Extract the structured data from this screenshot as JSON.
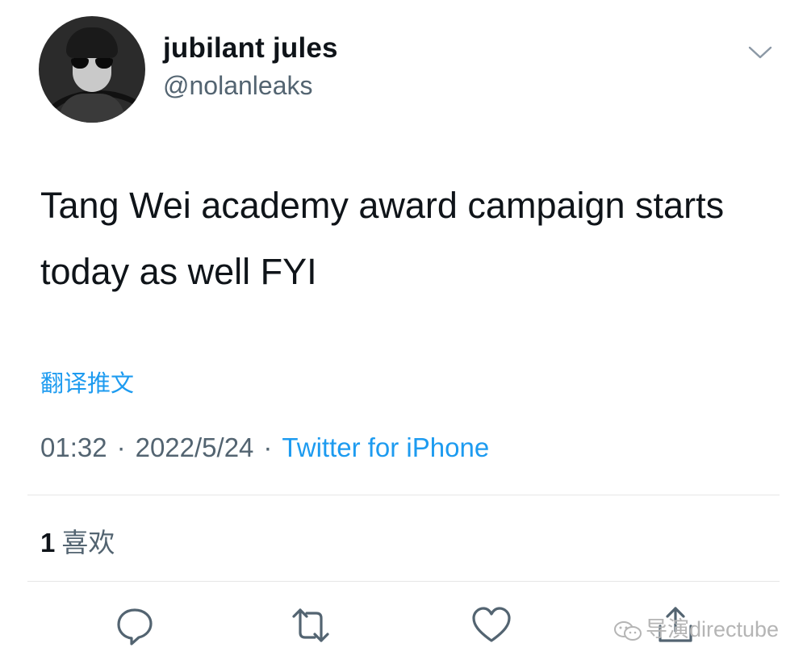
{
  "tweet": {
    "author_name": "jubilant jules",
    "author_handle": "@nolanleaks",
    "text": "Tang Wei academy award campaign starts today as well FYI",
    "translate_label": "翻译推文",
    "time": "01:32",
    "date": "2022/5/24",
    "separator": "·",
    "source": "Twitter for iPhone",
    "likes_count": "1",
    "likes_label": "喜欢"
  },
  "actions": {
    "reply_icon": "reply-icon",
    "retweet_icon": "retweet-icon",
    "like_icon": "like-icon",
    "share_icon": "share-icon"
  },
  "watermark": {
    "text": "导演directube"
  },
  "colors": {
    "accent": "#1d9bf0",
    "secondary_text": "#536471",
    "primary_text": "#0f1419"
  }
}
